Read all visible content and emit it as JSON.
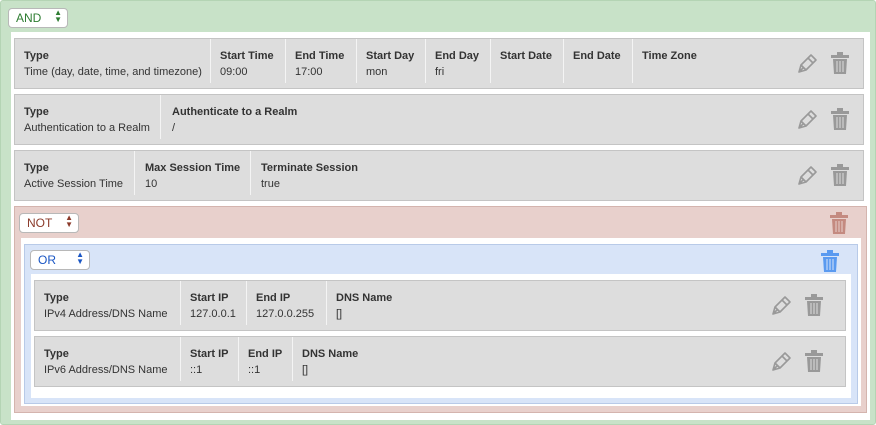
{
  "root": {
    "operator": "AND"
  },
  "conditions": [
    {
      "columns": [
        {
          "h": "Type",
          "v": "Time (day, date, time, and timezone)"
        },
        {
          "h": "Start Time",
          "v": "09:00"
        },
        {
          "h": "End Time",
          "v": "17:00"
        },
        {
          "h": "Start Day",
          "v": "mon"
        },
        {
          "h": "End Day",
          "v": "fri"
        },
        {
          "h": "Start Date",
          "v": ""
        },
        {
          "h": "End Date",
          "v": ""
        },
        {
          "h": "Time Zone",
          "v": ""
        }
      ]
    },
    {
      "columns": [
        {
          "h": "Type",
          "v": "Authentication to a Realm"
        },
        {
          "h": "Authenticate to a Realm",
          "v": "/"
        }
      ]
    },
    {
      "columns": [
        {
          "h": "Type",
          "v": "Active Session Time"
        },
        {
          "h": "Max Session Time",
          "v": "10"
        },
        {
          "h": "Terminate Session",
          "v": "true"
        }
      ]
    }
  ],
  "not_group": {
    "operator": "NOT",
    "or_group": {
      "operator": "OR",
      "conditions": [
        {
          "columns": [
            {
              "h": "Type",
              "v": "IPv4 Address/DNS Name"
            },
            {
              "h": "Start IP",
              "v": "127.0.0.1"
            },
            {
              "h": "End IP",
              "v": "127.0.0.255"
            },
            {
              "h": "DNS Name",
              "v": "[]"
            }
          ]
        },
        {
          "columns": [
            {
              "h": "Type",
              "v": "IPv6 Address/DNS Name"
            },
            {
              "h": "Start IP",
              "v": "::1"
            },
            {
              "h": "End IP",
              "v": "::1"
            },
            {
              "h": "DNS Name",
              "v": "[]"
            }
          ]
        }
      ]
    }
  },
  "icons": {
    "edit": "pencil-icon",
    "delete": "trash-icon"
  },
  "colors": {
    "and_bg": "#c8e2c8",
    "and_text": "#2e7d32",
    "not_bg": "#e8d0cc",
    "not_text": "#8b3a2a",
    "or_bg": "#d8e4f8",
    "or_text": "#1a56c4",
    "row_bg": "#dddddd",
    "icon_gray": "#999999",
    "trash_red": "#c48a80",
    "trash_blue": "#5a9af0"
  }
}
